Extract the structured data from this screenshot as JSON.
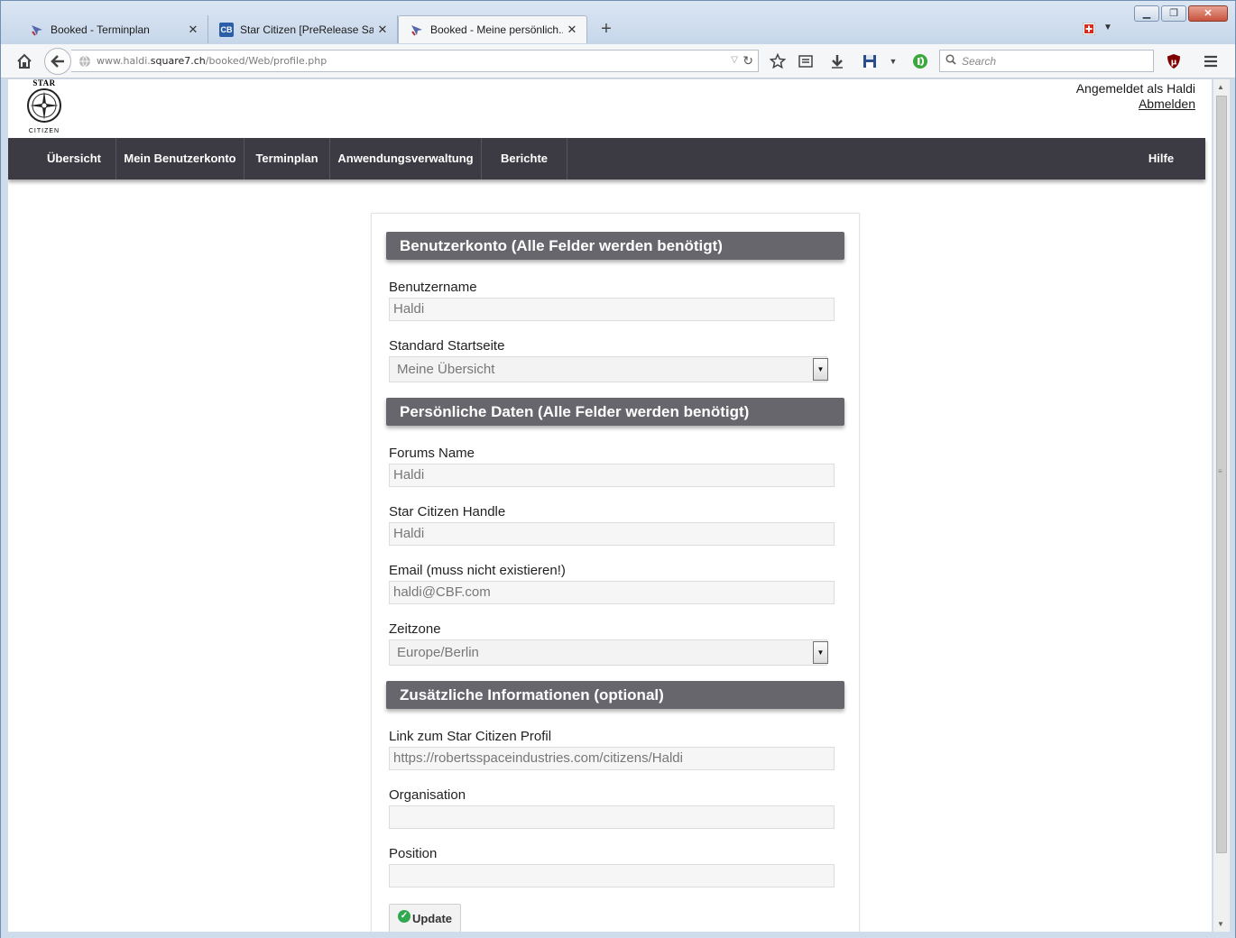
{
  "browser": {
    "tabs": [
      {
        "title": "Booked - Terminplan",
        "active": false
      },
      {
        "title": "Star Citizen [PreRelease Sa...",
        "active": false
      },
      {
        "title": "Booked - Meine persönlich...",
        "active": true
      }
    ],
    "url_prefix": "www.haldi.",
    "url_domain": "square7.ch",
    "url_path": "/booked/Web/profile.php",
    "search_placeholder": "Search"
  },
  "header": {
    "logo_top": "STAR",
    "logo_bottom": "CITIZEN",
    "logged_in_as": "Angemeldet als Haldi",
    "logout": "Abmelden"
  },
  "nav": {
    "items": [
      "Übersicht",
      "Mein Benutzerkonto",
      "Terminplan",
      "Anwendungsverwaltung",
      "Berichte"
    ],
    "help": "Hilfe"
  },
  "form": {
    "section_account": "Benutzerkonto (Alle Felder werden benötigt)",
    "username_label": "Benutzername",
    "username_value": "Haldi",
    "homepage_label": "Standard Startseite",
    "homepage_value": "Meine Übersicht",
    "section_personal": "Persönliche Daten (Alle Felder werden benötigt)",
    "forums_label": "Forums Name",
    "forums_value": "Haldi",
    "handle_label": "Star Citizen Handle",
    "handle_value": "Haldi",
    "email_label": "Email (muss nicht existieren!)",
    "email_value": "haldi@CBF.com",
    "timezone_label": "Zeitzone",
    "timezone_value": "Europe/Berlin",
    "section_extra": "Zusätzliche Informationen (optional)",
    "profile_link_label": "Link zum Star Citizen Profil",
    "profile_link_value": "https://robertsspaceindustries.com/citizens/Haldi",
    "organisation_label": "Organisation",
    "organisation_value": "",
    "position_label": "Position",
    "position_value": "",
    "update_button": "Update"
  },
  "colors": {
    "nav_bg": "#3c3b43",
    "section_bg": "#67666d",
    "update_check": "#2fa84f"
  }
}
